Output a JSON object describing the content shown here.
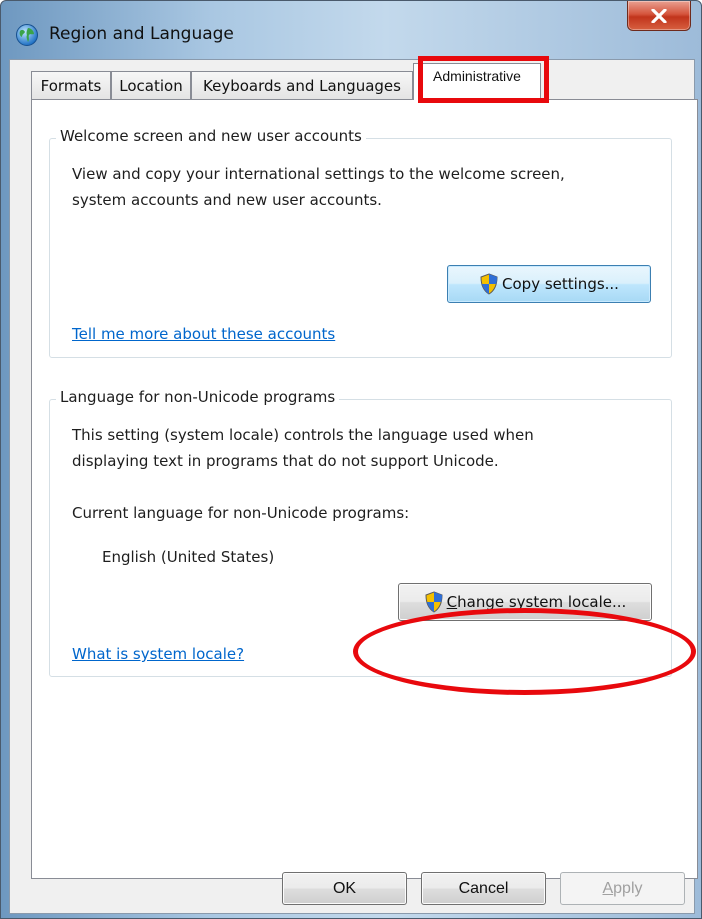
{
  "window": {
    "title": "Region and Language",
    "icon": "globe-icon",
    "close_icon": "close-icon"
  },
  "tabs": [
    {
      "label": "Formats",
      "selected": false
    },
    {
      "label": "Location",
      "selected": false
    },
    {
      "label": "Keyboards and Languages",
      "selected": false
    },
    {
      "label": "Administrative",
      "selected": true
    }
  ],
  "welcome_group": {
    "legend": "Welcome screen and new user accounts",
    "line1": "View and copy your international settings to the welcome screen,",
    "line2": "system accounts and new user accounts.",
    "button_label": "Copy settings...",
    "button_icon": "uac-shield-icon",
    "link": "Tell me more about these accounts"
  },
  "locale_group": {
    "legend": "Language for non-Unicode programs",
    "line1": "This setting (system locale) controls the language used when",
    "line2": "displaying text in programs that do not support Unicode.",
    "current_label": "Current language for non-Unicode programs:",
    "current_value": "English (United States)",
    "button_mnemonic": "C",
    "button_rest": "hange system locale...",
    "button_icon": "uac-shield-icon",
    "link": "What is system locale?"
  },
  "buttons": {
    "ok": "OK",
    "cancel": "Cancel",
    "apply_mnemonic": "A",
    "apply_rest": "pply",
    "apply_enabled": false
  },
  "annotation_color": "#e8090d"
}
